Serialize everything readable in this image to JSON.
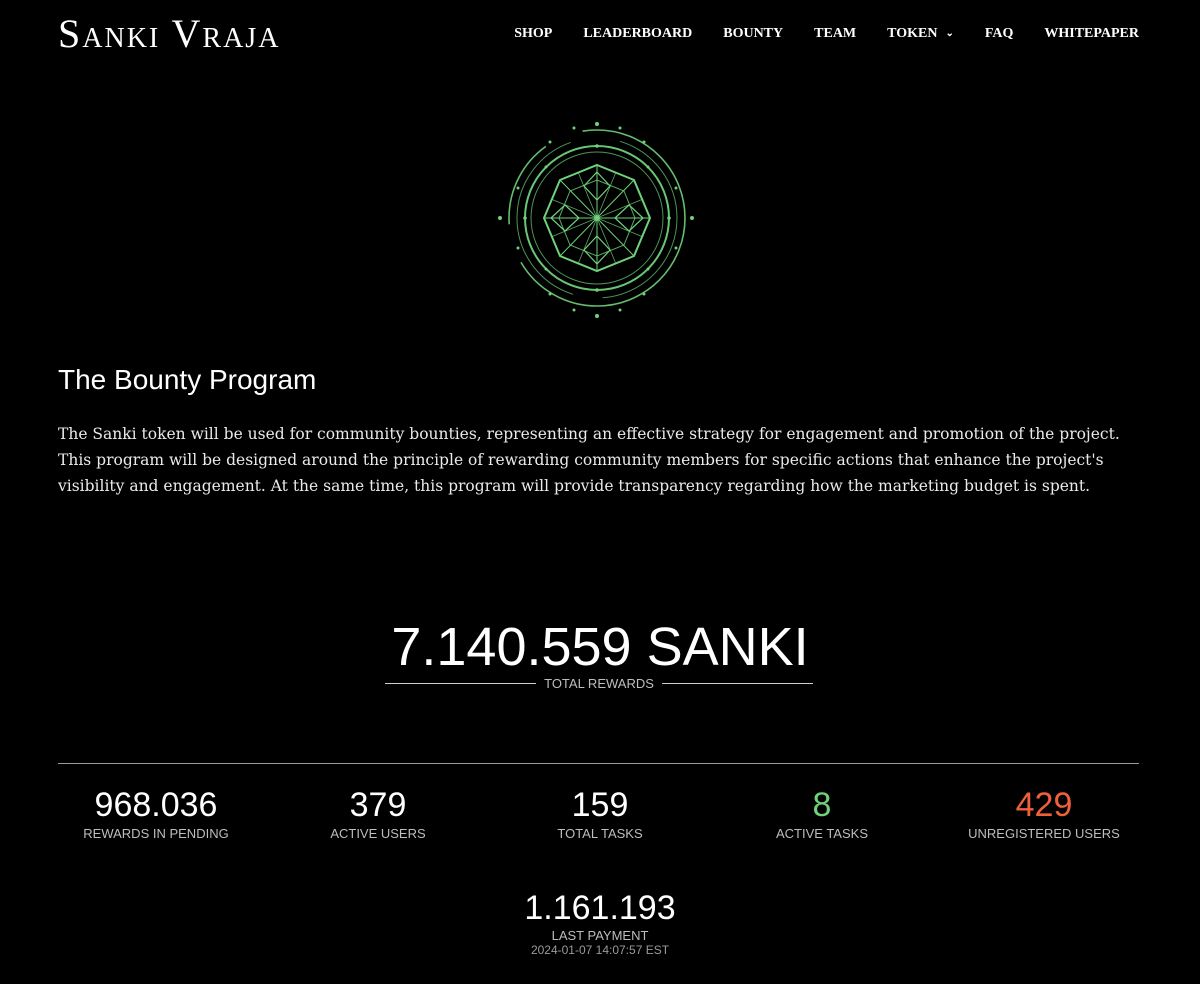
{
  "brand": {
    "name": "Sanki Vraja"
  },
  "nav": {
    "items": [
      {
        "label": "SHOP"
      },
      {
        "label": "LEADERBOARD"
      },
      {
        "label": "BOUNTY"
      },
      {
        "label": "TEAM"
      },
      {
        "label": "TOKEN",
        "has_dropdown": true
      },
      {
        "label": "FAQ"
      },
      {
        "label": "WHITEPAPER"
      }
    ]
  },
  "intro": {
    "title": "The Bounty Program",
    "description": "The Sanki token will be used for community bounties, representing an effective strategy for engagement and promotion of the project. This program will be designed around the principle of rewarding community members for specific actions that enhance the project's visibility and engagement. At the same time, this program will provide transparency regarding how the marketing budget is spent."
  },
  "total": {
    "value": "7.140.559 SANKI",
    "label": "TOTAL REWARDS"
  },
  "stats": [
    {
      "value": "968.036",
      "label": "REWARDS IN PENDING",
      "color": "#ffffff"
    },
    {
      "value": "379",
      "label": "ACTIVE USERS",
      "color": "#ffffff"
    },
    {
      "value": "159",
      "label": "TOTAL TASKS",
      "color": "#ffffff"
    },
    {
      "value": "8",
      "label": "ACTIVE TASKS",
      "color": "#6fd17a"
    },
    {
      "value": "429",
      "label": "UNREGISTERED USERS",
      "color": "#f0603a"
    }
  ],
  "last_payment": {
    "value": "1.161.193",
    "label": "LAST PAYMENT",
    "time": "2024-01-07 14:07:57 EST"
  },
  "theme": {
    "accent_green": "#6fd17a",
    "accent_red": "#f0603a",
    "background": "#000000"
  }
}
